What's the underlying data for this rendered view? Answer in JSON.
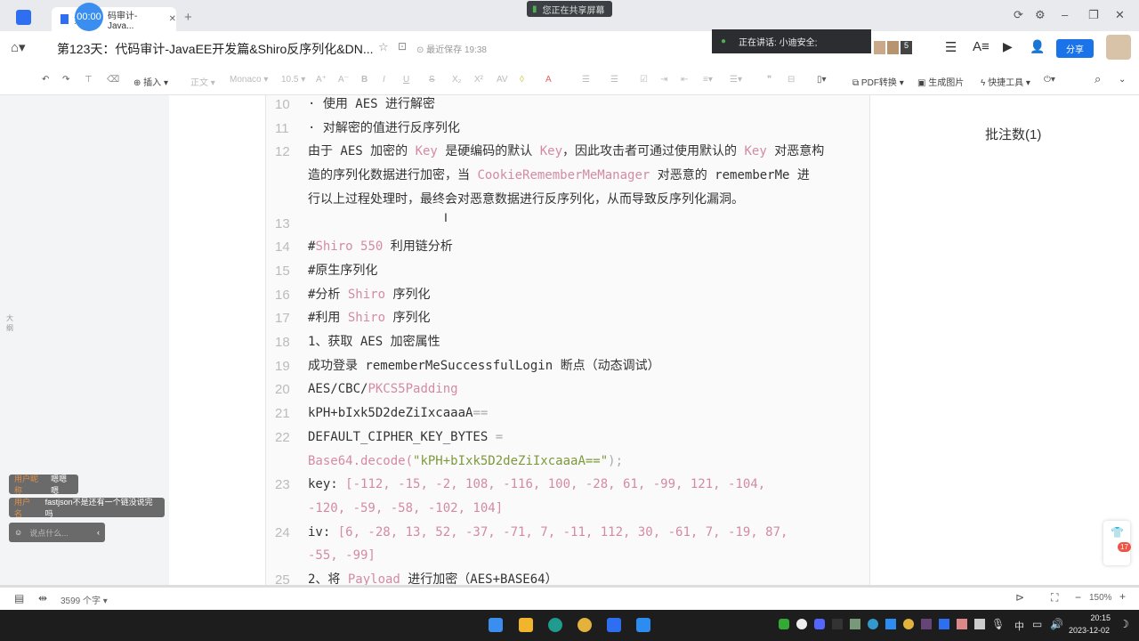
{
  "window": {
    "tab_label": "第123天：代码审计-Java...",
    "tab_prefix": "第",
    "tab_suffix": "码审计-Java...",
    "timer": "00:00",
    "share_notice": "您正在共享屏幕"
  },
  "header": {
    "title": "第123天：代码审计-JavaEE开发篇&Shiro反序列化&DN...",
    "save_status": "最近保存 19:38",
    "speaking": "正在讲话:  小迪安全;",
    "avatar_count": "5",
    "share": "分享"
  },
  "toolbar": {
    "insert": "插入",
    "style": "正文",
    "font": "Monaco",
    "size": "10.5",
    "pdf": "PDF转换",
    "image": "生成图片",
    "quick": "快捷工具"
  },
  "sidebar": {
    "outline": "大纲"
  },
  "right_panel": {
    "comments": "批注数(1)"
  },
  "document": {
    "lines": [
      {
        "num": "10",
        "rows": [
          [
            [
              "· 使用 AES 进行解密",
              ""
            ]
          ]
        ]
      },
      {
        "num": "11",
        "rows": [
          [
            [
              "· 对解密的值进行反序列化",
              ""
            ]
          ]
        ]
      },
      {
        "num": "12",
        "rows": [
          [
            [
              "由于 AES 加密的 ",
              ""
            ],
            [
              "Key",
              "p"
            ],
            [
              " 是硬编码的默认 ",
              ""
            ],
            [
              "Key",
              "p"
            ],
            [
              "，因此攻击者可通过使用默认的 ",
              ""
            ],
            [
              "Key",
              "p"
            ],
            [
              " 对恶意构",
              ""
            ]
          ],
          [
            [
              "造的序列化数据进行加密，当 ",
              ""
            ],
            [
              "CookieRememberMeManager",
              "p"
            ],
            [
              " 对恶意的 rememberMe 进",
              ""
            ]
          ],
          [
            [
              "行以上过程处理时，最终会对恶意数据进行反序列化，从而导致反序列化漏洞。",
              ""
            ]
          ]
        ]
      },
      {
        "num": "13",
        "rows": [
          [
            [
              "",
              ""
            ]
          ]
        ]
      },
      {
        "num": "14",
        "rows": [
          [
            [
              "#",
              ""
            ],
            [
              "Shiro 550",
              "p"
            ],
            [
              " 利用链分析",
              ""
            ]
          ]
        ]
      },
      {
        "num": "15",
        "rows": [
          [
            [
              "#原生序列化",
              ""
            ]
          ]
        ]
      },
      {
        "num": "16",
        "rows": [
          [
            [
              "#分析 ",
              ""
            ],
            [
              "Shiro",
              "p"
            ],
            [
              " 序列化",
              ""
            ]
          ]
        ]
      },
      {
        "num": "17",
        "rows": [
          [
            [
              "#利用 ",
              ""
            ],
            [
              "Shiro",
              "p"
            ],
            [
              " 序列化",
              ""
            ]
          ]
        ]
      },
      {
        "num": "18",
        "rows": [
          [
            [
              "1、获取 AES 加密属性",
              ""
            ]
          ]
        ]
      },
      {
        "num": "19",
        "rows": [
          [
            [
              "成功登录 rememberMeSuccessfulLogin 断点（动态调试）",
              ""
            ]
          ]
        ]
      },
      {
        "num": "20",
        "rows": [
          [
            [
              "AES/CBC/",
              ""
            ],
            [
              "PKCS5Padding",
              "p"
            ]
          ]
        ]
      },
      {
        "num": "21",
        "rows": [
          [
            [
              "kPH+bIxk5D2deZiIxcaaaA",
              ""
            ],
            [
              "==",
              "d"
            ]
          ]
        ]
      },
      {
        "num": "22",
        "rows": [
          [
            [
              "DEFAULT_CIPHER_KEY_BYTES ",
              ""
            ],
            [
              "=",
              "d"
            ]
          ],
          [
            [
              "Base64.decode(",
              "p"
            ],
            [
              "\"kPH+bIxk5D2deZiIxcaaaA==\"",
              "g"
            ],
            [
              ");",
              "d"
            ]
          ]
        ]
      },
      {
        "num": "23",
        "rows": [
          [
            [
              "key: ",
              ""
            ],
            [
              "[-112, -15, -2, 108, -116, 100, -28, 61, -99, 121, -104,",
              "p"
            ]
          ],
          [
            [
              "-120, -59, -58, -102, 104]",
              "p"
            ]
          ]
        ]
      },
      {
        "num": "24",
        "rows": [
          [
            [
              "iv: ",
              ""
            ],
            [
              "[6, -28, 13, 52, -37, -71, 7, -11, 112, 30, -61, 7, -19, 87,",
              "p"
            ]
          ],
          [
            [
              "-55, -99]",
              "p"
            ]
          ]
        ]
      },
      {
        "num": "25",
        "rows": [
          [
            [
              "2、将 ",
              ""
            ],
            [
              "Payload",
              "p"
            ],
            [
              " 进行加密（AES+BASE64）",
              ""
            ]
          ]
        ]
      }
    ]
  },
  "chat": {
    "messages": [
      {
        "user": "用户昵称",
        "text": "嗯嗯嗯"
      },
      {
        "user": "用户名",
        "text": "fastjson不是还有一个链没说完吗"
      }
    ],
    "input_placeholder": "说点什么..."
  },
  "statusbar": {
    "word_count": "3599 个字",
    "zoom": "150%",
    "badge": "17"
  },
  "taskbar": {
    "time": "20:15",
    "date": "2023-12-02",
    "ime": "中"
  }
}
